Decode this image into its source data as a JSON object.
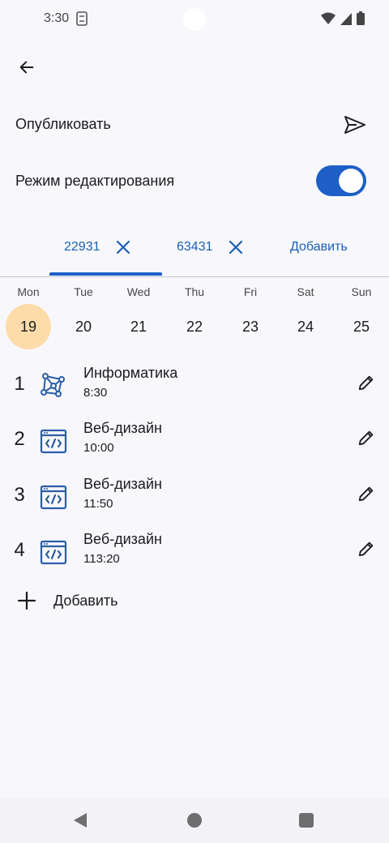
{
  "status": {
    "time": "3:30"
  },
  "publish": {
    "label": "Опубликовать"
  },
  "edit_mode": {
    "label": "Режим редактирования",
    "enabled": true
  },
  "tabs": [
    {
      "label": "22931",
      "selected": true
    },
    {
      "label": "63431",
      "selected": false
    }
  ],
  "tab_add_label": "Добавить",
  "week": {
    "days": [
      {
        "name": "Mon",
        "num": "19",
        "selected": true
      },
      {
        "name": "Tue",
        "num": "20"
      },
      {
        "name": "Wed",
        "num": "21"
      },
      {
        "name": "Thu",
        "num": "22"
      },
      {
        "name": "Fri",
        "num": "23"
      },
      {
        "name": "Sat",
        "num": "24"
      },
      {
        "name": "Sun",
        "num": "25"
      }
    ]
  },
  "lessons": [
    {
      "num": "1",
      "name": "Информатика",
      "time": "8:30",
      "icon": "network-graph-icon"
    },
    {
      "num": "2",
      "name": "Веб-дизайн",
      "time": "10:00",
      "icon": "code-window-icon"
    },
    {
      "num": "3",
      "name": "Веб-дизайн",
      "time": "11:50",
      "icon": "code-window-icon"
    },
    {
      "num": "4",
      "name": "Веб-дизайн",
      "time": "113:20",
      "icon": "code-window-icon"
    }
  ],
  "add_lesson_label": "Добавить",
  "colors": {
    "accent": "#1d5fc7",
    "selected_day": "#fddcaa",
    "icon_blue": "#2a5da8"
  }
}
